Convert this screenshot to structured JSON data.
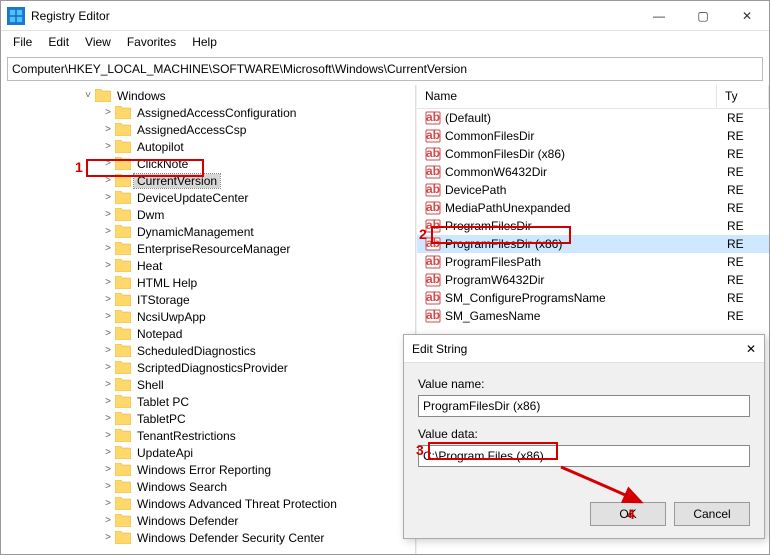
{
  "window": {
    "title": "Registry Editor",
    "min": "—",
    "max": "▢",
    "close": "✕"
  },
  "menu": {
    "file": "File",
    "edit": "Edit",
    "view": "View",
    "favorites": "Favorites",
    "help": "Help"
  },
  "address": {
    "path": "Computer\\HKEY_LOCAL_MACHINE\\SOFTWARE\\Microsoft\\Windows\\CurrentVersion"
  },
  "tree": {
    "root": "Windows",
    "nodes": [
      "AssignedAccessConfiguration",
      "AssignedAccessCsp",
      "Autopilot",
      "ClickNote",
      "CurrentVersion",
      "DeviceUpdateCenter",
      "Dwm",
      "DynamicManagement",
      "EnterpriseResourceManager",
      "Heat",
      "HTML Help",
      "ITStorage",
      "NcsiUwpApp",
      "Notepad",
      "ScheduledDiagnostics",
      "ScriptedDiagnosticsProvider",
      "Shell",
      "Tablet PC",
      "TabletPC",
      "TenantRestrictions",
      "UpdateApi",
      "Windows Error Reporting",
      "Windows Search",
      "Windows Advanced Threat Protection",
      "Windows Defender",
      "Windows Defender Security Center"
    ]
  },
  "list": {
    "header_name": "Name",
    "header_type": "Ty",
    "type_prefix": "RE",
    "values": [
      "(Default)",
      "CommonFilesDir",
      "CommonFilesDir (x86)",
      "CommonW6432Dir",
      "DevicePath",
      "MediaPathUnexpanded",
      "ProgramFilesDir",
      "ProgramFilesDir (x86)",
      "ProgramFilesPath",
      "ProgramW6432Dir",
      "SM_ConfigureProgramsName",
      "SM_GamesName"
    ],
    "selected_index": 7
  },
  "dialog": {
    "title": "Edit String",
    "close": "✕",
    "name_label": "Value name:",
    "name_value": "ProgramFilesDir (x86)",
    "data_label": "Value data:",
    "data_value": "C:\\Program Files (x86)",
    "ok": "OK",
    "cancel": "Cancel"
  },
  "annotations": {
    "n1": "1",
    "n2": "2",
    "n3": "3",
    "n4": "4"
  }
}
